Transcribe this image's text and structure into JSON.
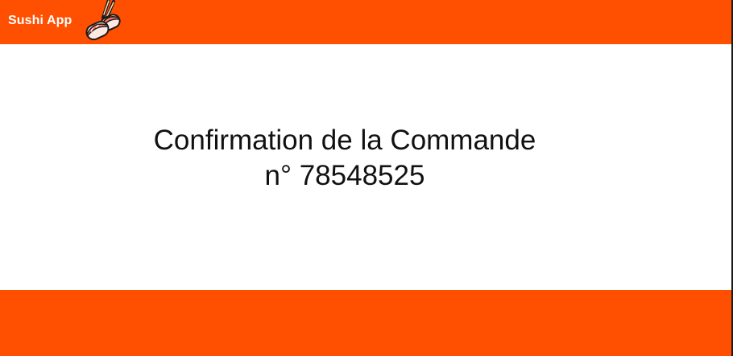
{
  "header": {
    "app_title": "Sushi App",
    "logo_icon": "sushi-chopsticks-icon",
    "background_color": "#ff4f00"
  },
  "main": {
    "confirmation_title": "Confirmation de la Commande",
    "order_number": "n° 78548525"
  },
  "footer": {
    "background_color": "#ff4f00"
  }
}
